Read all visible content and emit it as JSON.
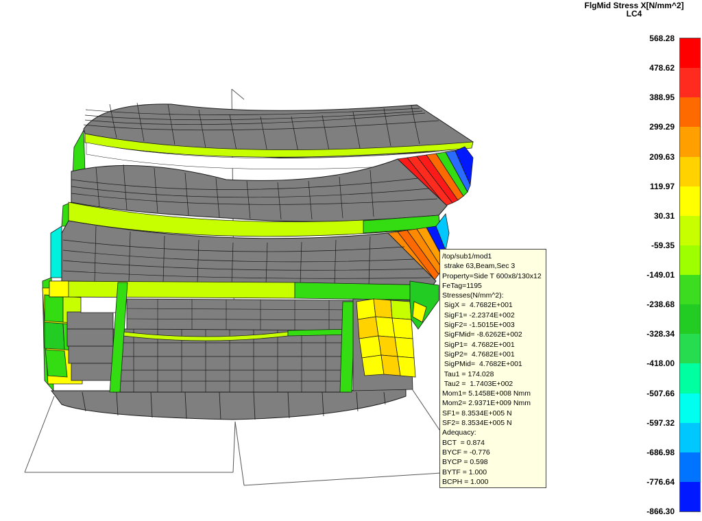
{
  "legend": {
    "title": "FlgMid Stress X[N/mm^2]",
    "subtitle": "LC4",
    "labels": [
      "568.28",
      "478.62",
      "388.95",
      "299.29",
      "209.63",
      "119.97",
      "30.31",
      "-59.35",
      "-149.01",
      "-238.68",
      "-328.34",
      "-418.00",
      "-507.66",
      "-597.32",
      "-686.98",
      "-776.64",
      "-866.30"
    ],
    "colors": [
      "#ff0000",
      "#ff2b1f",
      "#ff6a00",
      "#ff9f00",
      "#ffd200",
      "#ffff00",
      "#c8ff00",
      "#9dff00",
      "#3cdc20",
      "#22cc22",
      "#28dc50",
      "#00ffa0",
      "#00ffee",
      "#00c8ff",
      "#0073ff",
      "#0019ff"
    ]
  },
  "info": {
    "lines": [
      "/top/sub1/mod1",
      " strake 63,Beam,Sec 3",
      "Property=Side T 600x8/130x12",
      "FeTag=1195",
      "Stresses(N/mm^2):",
      " SigX =  4.7682E+001",
      " SigF1= -2.2374E+002",
      " SigF2= -1.5015E+003",
      " SigFMid= -8.6262E+002",
      " SigP1=  4.7682E+001",
      " SigP2=  4.7682E+001",
      " SigPMid=  4.7682E+001",
      " Tau1 = 174.028",
      " Tau2 =  1.7403E+002",
      "Mom1= 5.1458E+008 Nmm",
      "Mom2= 2.9371E+009 Nmm",
      "SF1= 8.3534E+005 N",
      "SF2= 8.3534E+005 N",
      "Adequacy:",
      "BCT  = 0.874",
      "BYCF = -0.776",
      "BYCP = 0.598",
      "BYTF = 1.000",
      "BCPH = 1.000"
    ]
  },
  "model": {
    "colors": {
      "plate": "#7f7f7f",
      "mesh": "#1a1a1a",
      "white": "#ffffff",
      "red": "#ff1a1a",
      "orange": "#ff8a00",
      "yellow": "#ffff00",
      "lime": "#c8ff00",
      "green": "#33dd11",
      "green2": "#22cc22",
      "cyan": "#00f0e0",
      "blue": "#0019ff",
      "blue2": "#2a6cff"
    }
  }
}
